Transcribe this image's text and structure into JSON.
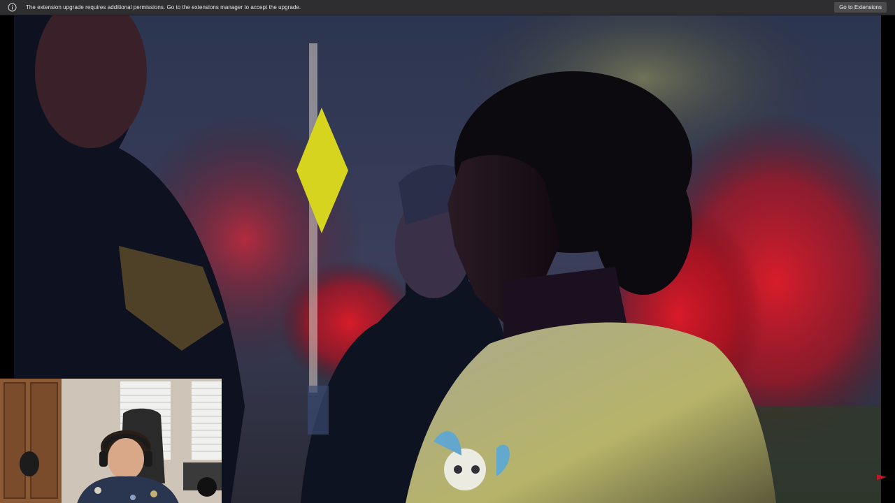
{
  "notification": {
    "icon": "info-icon",
    "message": "The extension upgrade requires additional permissions. Go to the extensions manager to accept the upgrade.",
    "button_label": "Go to Extensions"
  },
  "video": {
    "scene_icon": "video-frame",
    "webcam_icon": "webcam-feed"
  },
  "colors": {
    "bar_bg": "#2e2e30",
    "button_bg": "#4a4a4d",
    "text": "#e6e6e6"
  }
}
